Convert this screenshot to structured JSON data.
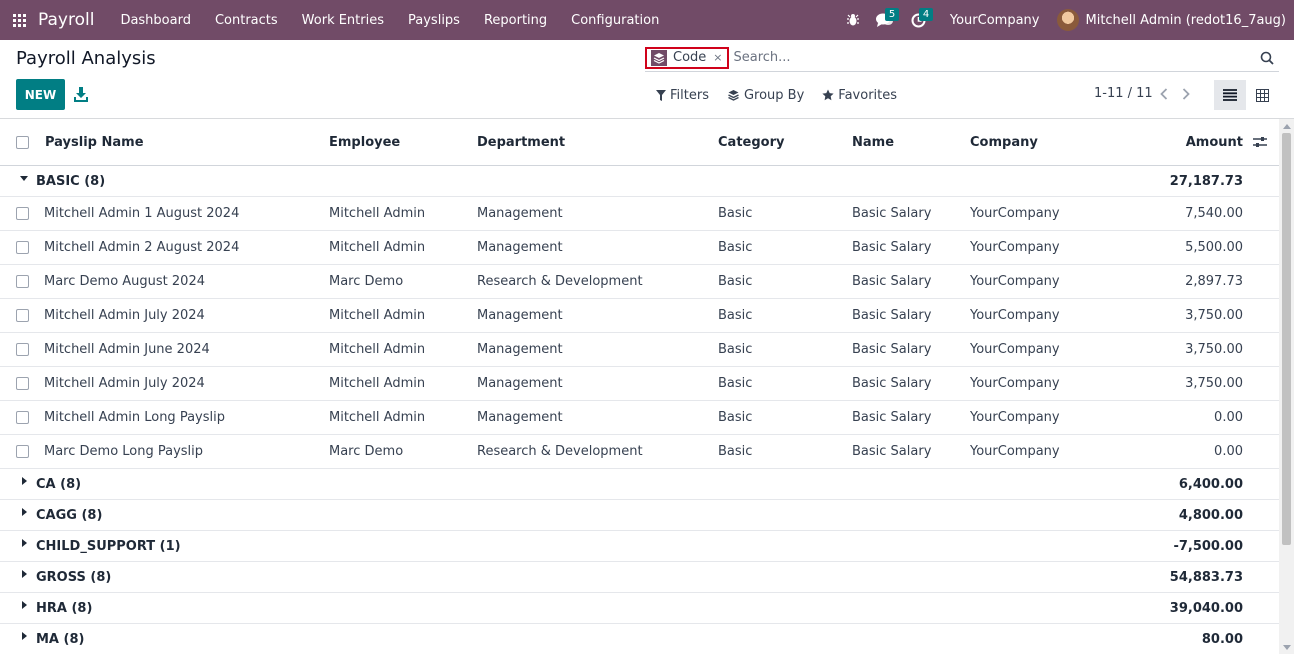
{
  "nav": {
    "app_name": "Payroll",
    "menu": [
      "Dashboard",
      "Contracts",
      "Work Entries",
      "Payslips",
      "Reporting",
      "Configuration"
    ],
    "messages_count": "5",
    "activities_count": "4",
    "company": "YourCompany",
    "user": "Mitchell Admin (redot16_7aug)"
  },
  "page": {
    "title": "Payroll Analysis",
    "new_label": "NEW"
  },
  "search": {
    "facet_label": "Code",
    "facet_close": "×",
    "placeholder": "Search..."
  },
  "filters": {
    "filters_label": "Filters",
    "groupby_label": "Group By",
    "favorites_label": "Favorites"
  },
  "pager": {
    "value": "1-11 / 11"
  },
  "table": {
    "columns": [
      "Payslip Name",
      "Employee",
      "Department",
      "Category",
      "Name",
      "Company",
      "Amount"
    ],
    "groups": [
      {
        "label": "BASIC (8)",
        "total": "27,187.73",
        "expanded": true,
        "rows": [
          [
            "Mitchell Admin 1 August 2024",
            "Mitchell Admin",
            "Management",
            "Basic",
            "Basic Salary",
            "YourCompany",
            "7,540.00"
          ],
          [
            "Mitchell Admin 2 August 2024",
            "Mitchell Admin",
            "Management",
            "Basic",
            "Basic Salary",
            "YourCompany",
            "5,500.00"
          ],
          [
            "Marc Demo August 2024",
            "Marc Demo",
            "Research & Development",
            "Basic",
            "Basic Salary",
            "YourCompany",
            "2,897.73"
          ],
          [
            "Mitchell Admin July 2024",
            "Mitchell Admin",
            "Management",
            "Basic",
            "Basic Salary",
            "YourCompany",
            "3,750.00"
          ],
          [
            "Mitchell Admin June 2024",
            "Mitchell Admin",
            "Management",
            "Basic",
            "Basic Salary",
            "YourCompany",
            "3,750.00"
          ],
          [
            "Mitchell Admin July 2024",
            "Mitchell Admin",
            "Management",
            "Basic",
            "Basic Salary",
            "YourCompany",
            "3,750.00"
          ],
          [
            "Mitchell Admin Long Payslip",
            "Mitchell Admin",
            "Management",
            "Basic",
            "Basic Salary",
            "YourCompany",
            "0.00"
          ],
          [
            "Marc Demo Long Payslip",
            "Marc Demo",
            "Research & Development",
            "Basic",
            "Basic Salary",
            "YourCompany",
            "0.00"
          ]
        ]
      },
      {
        "label": "CA (8)",
        "total": "6,400.00",
        "expanded": false,
        "rows": []
      },
      {
        "label": "CAGG (8)",
        "total": "4,800.00",
        "expanded": false,
        "rows": []
      },
      {
        "label": "CHILD_SUPPORT (1)",
        "total": "-7,500.00",
        "expanded": false,
        "rows": []
      },
      {
        "label": "GROSS (8)",
        "total": "54,883.73",
        "expanded": false,
        "rows": []
      },
      {
        "label": "HRA (8)",
        "total": "39,040.00",
        "expanded": false,
        "rows": []
      },
      {
        "label": "MA (8)",
        "total": "80.00",
        "expanded": false,
        "rows": []
      }
    ]
  },
  "colors": {
    "brand": "#714B67",
    "primary": "#017E84",
    "highlight": "#d0021b"
  },
  "icons": [
    "apps-icon",
    "bug-icon",
    "chat-icon",
    "clock-icon",
    "layers-icon",
    "download-icon",
    "search-icon",
    "filter-icon",
    "star-icon",
    "chevron-left-icon",
    "chevron-right-icon",
    "list-view-icon",
    "pivot-view-icon",
    "column-settings-icon"
  ]
}
